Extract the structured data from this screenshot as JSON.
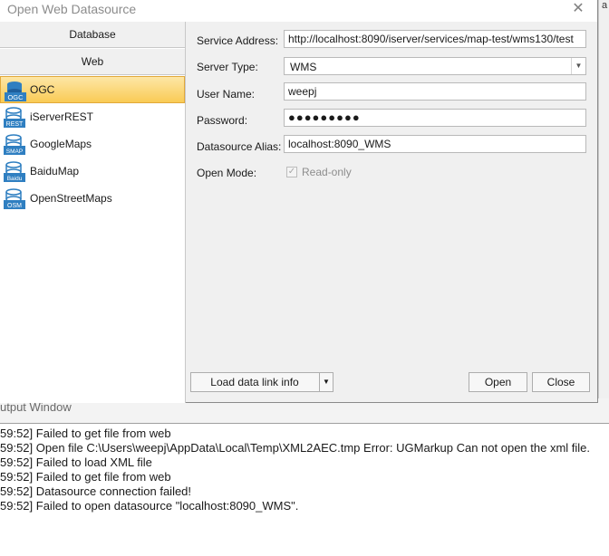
{
  "dialog": {
    "title": "Open Web Datasource",
    "close_glyph": "✕"
  },
  "categories": [
    {
      "label": "Database"
    },
    {
      "label": "Web"
    }
  ],
  "sources": [
    {
      "label": "OGC",
      "icon": "ogc-icon",
      "icon_text": "OGC",
      "selected": true
    },
    {
      "label": "iServerREST",
      "icon": "rest-icon",
      "icon_text": "REST"
    },
    {
      "label": "GoogleMaps",
      "icon": "smap-icon",
      "icon_text": "SMAP"
    },
    {
      "label": "BaiduMap",
      "icon": "baidu-icon",
      "icon_text": "Baidu"
    },
    {
      "label": "OpenStreetMaps",
      "icon": "osm-icon",
      "icon_text": "OSM"
    }
  ],
  "form": {
    "service_address_label": "Service Address:",
    "service_address_value": "http://localhost:8090/iserver/services/map-test/wms130/test",
    "server_type_label": "Server Type:",
    "server_type_value": "WMS",
    "user_name_label": "User Name:",
    "user_name_value": "weepj",
    "password_label": "Password:",
    "password_value": "●●●●●●●●●",
    "alias_label": "Datasource Alias:",
    "alias_value": "localhost:8090_WMS",
    "open_mode_label": "Open Mode:",
    "readonly_label": "Read-only",
    "readonly_checked": true,
    "check_glyph": "✓"
  },
  "buttons": {
    "load_label": "Load data link info",
    "load_arrow": "▼",
    "open_label": "Open",
    "close_label": "Close"
  },
  "background": {
    "corner_char": "a",
    "output_title": "utput Window",
    "log": [
      "59:52] Failed to get file from web",
      "59:52] Open file C:\\Users\\weepj\\AppData\\Local\\Temp\\XML2AEC.tmp Error: UGMarkup Can not open the xml file.",
      "59:52] Failed to load XML file",
      "59:52] Failed to get file from web",
      "59:52] Datasource connection failed!",
      "59:52] Failed to open datasource \"localhost:8090_WMS\"."
    ]
  },
  "colors": {
    "selected_item": "#f9cb55",
    "icon_blue": "#2f7fc1"
  }
}
